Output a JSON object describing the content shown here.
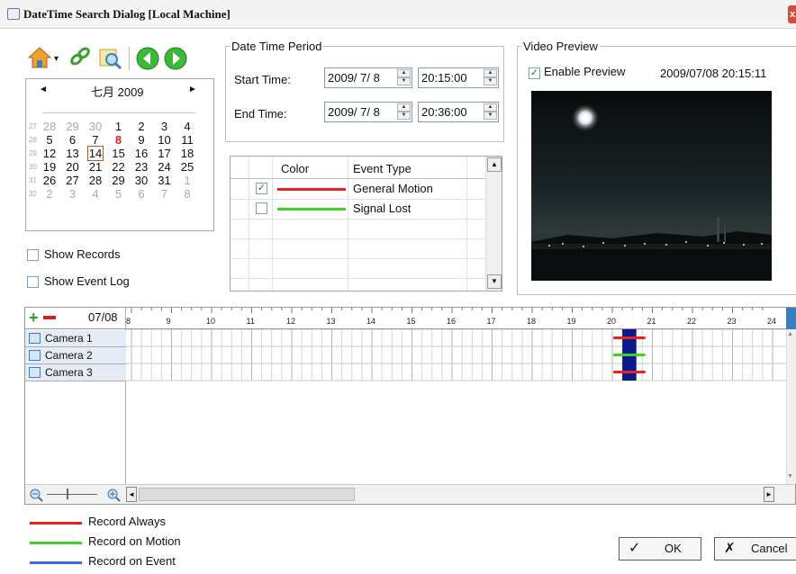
{
  "window": {
    "title": "DateTime Search Dialog  [Local Machine]",
    "close_glyph": "x"
  },
  "calendar": {
    "month_label": "七月 2009",
    "prev_arrow": "◄",
    "next_arrow": "►",
    "weeks": [
      {
        "num": "27",
        "days": [
          "28",
          "29",
          "30",
          "1",
          "2",
          "3",
          "4"
        ]
      },
      {
        "num": "28",
        "days": [
          "5",
          "6",
          "7",
          "8",
          "9",
          "10",
          "11"
        ]
      },
      {
        "num": "29",
        "days": [
          "12",
          "13",
          "14",
          "15",
          "16",
          "17",
          "18"
        ]
      },
      {
        "num": "30",
        "days": [
          "19",
          "20",
          "21",
          "22",
          "23",
          "24",
          "25"
        ]
      },
      {
        "num": "31",
        "days": [
          "26",
          "27",
          "28",
          "29",
          "30",
          "31",
          "1"
        ]
      },
      {
        "num": "32",
        "days": [
          "2",
          "3",
          "4",
          "5",
          "6",
          "7",
          "8"
        ]
      }
    ],
    "highlight_day": "8",
    "selected_day": "14"
  },
  "options": {
    "show_records": "Show Records",
    "show_event_log": "Show Event Log"
  },
  "date_time_period": {
    "legend": "Date Time Period",
    "start_label": "Start Time:",
    "start_date": "2009/ 7/ 8",
    "start_time": "20:15:00",
    "end_label": "End Time:",
    "end_date": "2009/ 7/ 8",
    "end_time": "20:36:00"
  },
  "event_table": {
    "headers": [
      "Color",
      "Event Type"
    ],
    "rows": [
      {
        "checked": true,
        "color": "#e8221e",
        "type": "General Motion"
      },
      {
        "checked": false,
        "color": "#43d02a",
        "type": "Signal Lost"
      }
    ]
  },
  "video_preview": {
    "legend": "Video Preview",
    "enable_label": "Enable Preview",
    "enable_checked": true,
    "timestamp": "2009/07/08 20:15:11"
  },
  "timeline": {
    "date": "07/08",
    "hours": [
      "8",
      "9",
      "10",
      "11",
      "12",
      "13",
      "14",
      "15",
      "16",
      "17",
      "18",
      "19",
      "20",
      "21",
      "22",
      "23",
      "24"
    ],
    "cameras": [
      "Camera 1",
      "Camera 2",
      "Camera 3"
    ],
    "selection_hour_start": 20.25,
    "selection_hour_end": 20.6,
    "marks": [
      {
        "camera": "Camera 1",
        "color": "#e8221e"
      },
      {
        "camera": "Camera 2",
        "color": "#43d02a"
      },
      {
        "camera": "Camera 3",
        "color": "#e8221e"
      }
    ]
  },
  "legend": [
    {
      "label": "Record Always",
      "color": "#e8221e"
    },
    {
      "label": "Record on Motion",
      "color": "#43d02a"
    },
    {
      "label": "Record on Event",
      "color": "#3c6be0"
    }
  ],
  "buttons": {
    "ok": "OK",
    "cancel": "Cancel"
  },
  "colors": {
    "selection": "#0a1a8a",
    "accent_border": "#c05a10"
  }
}
